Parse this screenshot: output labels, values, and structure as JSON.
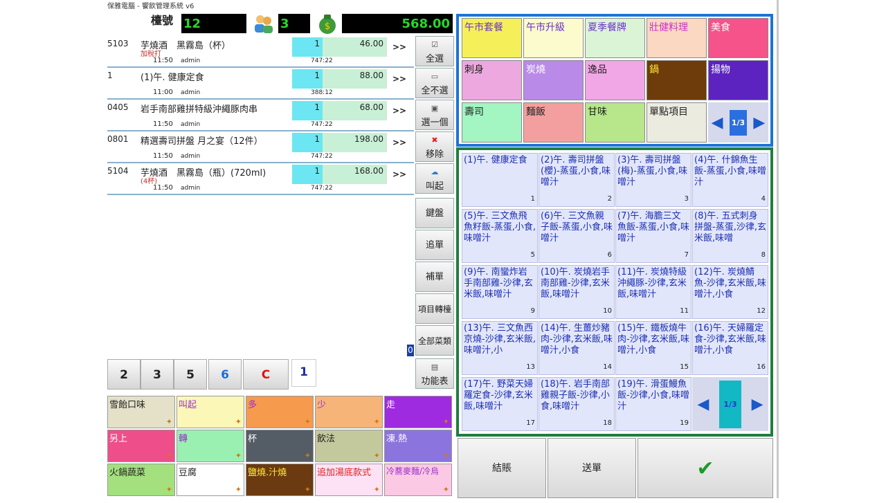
{
  "app_title": "保雅電腦 - 饗飲管理系統 v6",
  "header": {
    "table_label": "檯號",
    "table_no": "12",
    "guest_count": "3",
    "total": "568.00",
    "guests_icon": "people-icon",
    "money_icon": "money-bag-icon"
  },
  "orders": [
    {
      "code": "5103",
      "name": "芋燒酒　黑霧島（杯）",
      "sub": "加稅打",
      "time": "11:50",
      "user": "admin",
      "qty": "1",
      "price": "46.00",
      "more": ">>",
      "print": "747:22"
    },
    {
      "code": "1",
      "name": "(1)午. 健康定食",
      "sub": "",
      "time": "11:00",
      "user": "admin",
      "qty": "1",
      "price": "88.00",
      "more": ">>",
      "print": "388:12"
    },
    {
      "code": "0405",
      "name": "岩手南部雞拼特級沖繩豚肉串",
      "sub": "",
      "time": "11:50",
      "user": "admin",
      "qty": "1",
      "price": "68.00",
      "more": ">>",
      "print": "747:22"
    },
    {
      "code": "0801",
      "name": "精選壽司拼盤 月之宴（12件）",
      "sub": "",
      "time": "11:50",
      "user": "admin",
      "qty": "1",
      "price": "198.00",
      "more": ">>",
      "print": "747:22"
    },
    {
      "code": "5104",
      "name": "芋燒酒　黑霧島（瓶）(720ml)",
      "sub": "(4杯)",
      "time": "11:50",
      "user": "admin",
      "qty": "1",
      "price": "168.00",
      "more": ">>",
      "print": "747:22"
    }
  ],
  "side_buttons": [
    {
      "label": "全選",
      "icon": "check-all-icon"
    },
    {
      "label": "全不選",
      "icon": "uncheck-all-icon"
    },
    {
      "label": "選一個",
      "icon": "select-one-icon"
    },
    {
      "label": "移除",
      "icon": "remove-icon"
    },
    {
      "label": "叫起",
      "icon": "call-icon"
    },
    {
      "label": "鍵盤",
      "icon": ""
    },
    {
      "label": "追單",
      "icon": ""
    },
    {
      "label": "補單",
      "icon": ""
    },
    {
      "label": "項目轉檯",
      "icon": ""
    },
    {
      "label": "全部菜類",
      "icon": ""
    },
    {
      "label": "功能表",
      "icon": "menu-icon"
    }
  ],
  "counter_badge": "0",
  "numpad": [
    {
      "label": "2",
      "color": "#111111"
    },
    {
      "label": "3",
      "color": "#111111"
    },
    {
      "label": "5",
      "color": "#111111"
    },
    {
      "label": "6",
      "color": "#1a6fd6"
    },
    {
      "label": "C",
      "color": "#e01010"
    }
  ],
  "numpad_input": "1",
  "modifiers": [
    {
      "label": "雪飴口味",
      "bg": "#e4e1c8",
      "color": "#222"
    },
    {
      "label": "叫起",
      "bg": "#fbf7b7",
      "color": "#9b2fcf"
    },
    {
      "label": "多",
      "bg": "#f69a4e",
      "color": "#9b2fcf"
    },
    {
      "label": "少",
      "bg": "#f6b478",
      "color": "#9b2fcf"
    },
    {
      "label": "走",
      "bg": "#9e2be0",
      "color": "#fff"
    },
    {
      "label": "另上",
      "bg": "#ee4f8a",
      "color": "#fff"
    },
    {
      "label": "轉",
      "bg": "#9af0b1",
      "color": "#9b2fcf"
    },
    {
      "label": "杯",
      "bg": "#545d66",
      "color": "#fff"
    },
    {
      "label": "飲法",
      "bg": "#c4c89d",
      "color": "#222"
    },
    {
      "label": "凍.熱",
      "bg": "#8c74de",
      "color": "#fff"
    },
    {
      "label": "火鍋蔬菜",
      "bg": "#a4e07e",
      "color": "#222"
    },
    {
      "label": "豆腐",
      "bg": "#ffffff",
      "color": "#222"
    },
    {
      "label": "鹽燒.汁燒",
      "bg": "#6b3a10",
      "color": "#ffeb3b"
    },
    {
      "label": "追加湯底款式",
      "bg": "#fde2f5",
      "color": "#e02020"
    },
    {
      "label": "冷蕎麥麵/冷烏",
      "bg": "#fbc9e3",
      "color": "#9b2fcf"
    }
  ],
  "categories": [
    {
      "label": "午市套餐",
      "bg": "#f5f05a",
      "color": "#6b2fcf"
    },
    {
      "label": "午市升級",
      "bg": "#fbfbce",
      "color": "#6b2fcf"
    },
    {
      "label": "夏季餐牌",
      "bg": "#dcf4d6",
      "color": "#6b2fcf"
    },
    {
      "label": "壯健料理",
      "bg": "#fad8c2",
      "color": "#cf2fcf"
    },
    {
      "label": "美食",
      "bg": "#f5538a",
      "color": "#fff"
    },
    {
      "label": "刺身",
      "bg": "#eea8e0",
      "color": "#222"
    },
    {
      "label": "炭燒",
      "bg": "#b98ae8",
      "color": "#fff"
    },
    {
      "label": "逸品",
      "bg": "#f1a7e6",
      "color": "#222"
    },
    {
      "label": "鍋",
      "bg": "#6e3c0a",
      "color": "#ffeb3b"
    },
    {
      "label": "揚物",
      "bg": "#5d23c1",
      "color": "#fff"
    },
    {
      "label": "壽司",
      "bg": "#a3f5c2",
      "color": "#222"
    },
    {
      "label": "麵飯",
      "bg": "#f49f9f",
      "color": "#222"
    },
    {
      "label": "甘味",
      "bg": "#b8e68b",
      "color": "#222"
    },
    {
      "label": "單點項目",
      "bg": "#ecebe0",
      "color": "#222"
    }
  ],
  "category_pager": {
    "page": "1/3"
  },
  "items": [
    {
      "label": "(1)午. 健康定食",
      "num": "1"
    },
    {
      "label": "(2)午. 壽司拼盤(櫻)-蒸蛋,小食,味噌汁",
      "num": "2"
    },
    {
      "label": "(3)午. 壽司拼盤(梅)-蒸蛋,小食,味噌汁",
      "num": "3"
    },
    {
      "label": "(4)午. 什錦魚生飯-蒸蛋,小食,味噌汁",
      "num": "4"
    },
    {
      "label": "(5)午. 三文魚飛魚籽飯-蒸蛋,小食,味噌汁",
      "num": "5"
    },
    {
      "label": "(6)午. 三文魚親子飯-蒸蛋,小食,味噌汁",
      "num": "6"
    },
    {
      "label": "(7)午. 海膽三文魚飯-蒸蛋,小食,味噌汁",
      "num": "7"
    },
    {
      "label": "(8)午. 五式刺身拼盤-蒸蛋,沙律,玄米飯,味噌",
      "num": "8"
    },
    {
      "label": "(9)午. 南蠻炸岩手南部雞-沙律,玄米飯,味噌汁",
      "num": "9"
    },
    {
      "label": "(10)午. 炭燒岩手南部雞-沙律,玄米飯,味噌汁",
      "num": "10"
    },
    {
      "label": "(11)午. 炭燒特級沖繩豚-沙律,玄米飯,味噌汁",
      "num": "11"
    },
    {
      "label": "(12)午. 炭燒鯖魚-沙律,玄米飯,味噌汁,小食",
      "num": "12"
    },
    {
      "label": "(13)午. 三文魚西京燒-沙律,玄米飯,味噌汁,小",
      "num": "13"
    },
    {
      "label": "(14)午. 生薑炒豬肉-沙律,玄米飯,味噌汁,小食",
      "num": "14"
    },
    {
      "label": "(15)午. 鐵板燒牛肉-沙律,玄米飯,味噌汁,小食",
      "num": "15"
    },
    {
      "label": "(16)午. 天婦羅定食-沙律,玄米飯,味噌汁,小食",
      "num": "16"
    },
    {
      "label": "(17)午. 野菜天婦羅定食-沙律,玄米飯,味噌汁",
      "num": "17"
    },
    {
      "label": "(18)午. 岩手南部雞親子飯-沙律,小食,味噌汁",
      "num": "18"
    },
    {
      "label": "(19)午. 滑蛋鰻魚飯-沙律,小食,味噌汁",
      "num": "19"
    }
  ],
  "item_pager": {
    "page": "1/3"
  },
  "bottom": {
    "checkout": "結賬",
    "send": "送單",
    "confirm_icon": "checkmark-icon"
  }
}
